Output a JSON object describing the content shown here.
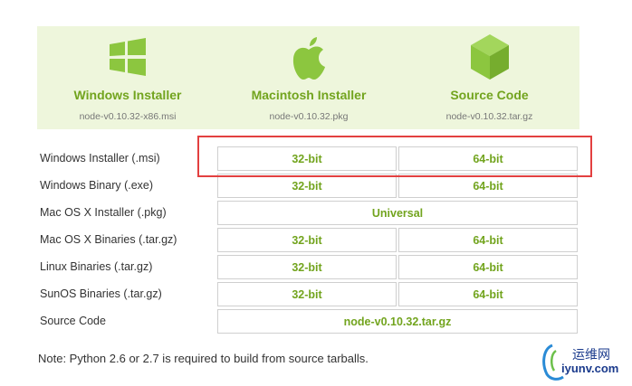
{
  "hero": [
    {
      "title": "Windows Installer",
      "file": "node-v0.10.32-x86.msi",
      "icon": "windows-logo-icon"
    },
    {
      "title": "Macintosh Installer",
      "file": "node-v0.10.32.pkg",
      "icon": "apple-logo-icon"
    },
    {
      "title": "Source Code",
      "file": "node-v0.10.32.tar.gz",
      "icon": "package-box-icon"
    }
  ],
  "rows": [
    {
      "label": "Windows Installer (.msi)",
      "links": [
        "32-bit",
        "64-bit"
      ]
    },
    {
      "label": "Windows Binary (.exe)",
      "links": [
        "32-bit",
        "64-bit"
      ]
    },
    {
      "label": "Mac OS X Installer (.pkg)",
      "links": [
        "Universal"
      ]
    },
    {
      "label": "Mac OS X Binaries (.tar.gz)",
      "links": [
        "32-bit",
        "64-bit"
      ]
    },
    {
      "label": "Linux Binaries (.tar.gz)",
      "links": [
        "32-bit",
        "64-bit"
      ]
    },
    {
      "label": "SunOS Binaries (.tar.gz)",
      "links": [
        "32-bit",
        "64-bit"
      ]
    },
    {
      "label": "Source Code",
      "links": [
        "node-v0.10.32.tar.gz"
      ]
    }
  ],
  "note": "Note: Python 2.6 or 2.7 is required to build from source tarballs.",
  "watermark": {
    "cn": "运维网",
    "url": "iyunv.com"
  },
  "colors": {
    "accent": "#72a41e",
    "hero_bg": "#eef6dc",
    "highlight": "#e34040"
  }
}
